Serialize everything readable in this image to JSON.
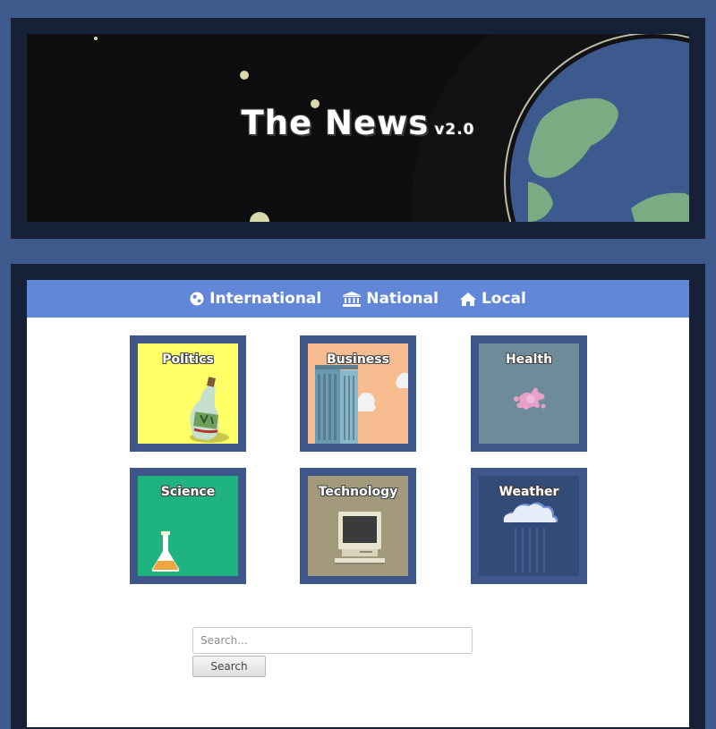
{
  "header": {
    "title": "The News",
    "version": "v2.0"
  },
  "nav": {
    "items": [
      {
        "label": "International",
        "icon": "globe-icon"
      },
      {
        "label": "National",
        "icon": "bank-icon"
      },
      {
        "label": "Local",
        "icon": "home-icon"
      }
    ]
  },
  "categories": [
    {
      "label": "Politics",
      "icon": "bottle-icon",
      "color": "#ffff66"
    },
    {
      "label": "Business",
      "icon": "skyscraper-icon",
      "color": "#f6bb8e"
    },
    {
      "label": "Health",
      "icon": "germ-icon",
      "color": "#6e8b99"
    },
    {
      "label": "Science",
      "icon": "flask-icon",
      "color": "#1fb380"
    },
    {
      "label": "Technology",
      "icon": "computer-icon",
      "color": "#a39a7c"
    },
    {
      "label": "Weather",
      "icon": "rain-cloud-icon",
      "color": "#324b79"
    }
  ],
  "search": {
    "placeholder": "Search...",
    "button_label": "Search"
  },
  "colors": {
    "page_background": "#3f5a8c",
    "frame": "#162036",
    "nav_bar": "#6287d8",
    "tile_border": "#3e5689"
  }
}
